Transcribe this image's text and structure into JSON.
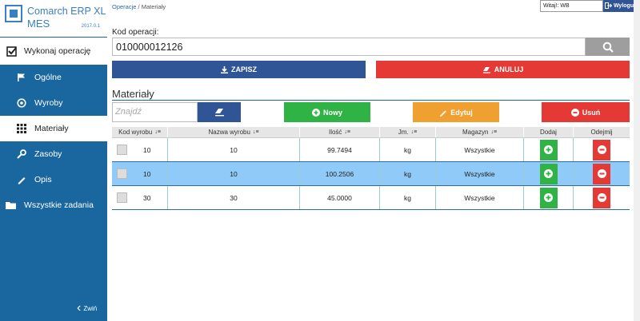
{
  "app": {
    "title": "Comarch ERP XL",
    "subtitle": "MES",
    "version": "2017.0.1"
  },
  "sidebar": {
    "top_item": "Wykonaj operację",
    "items": [
      {
        "label": "Ogólne",
        "icon": "flag-icon"
      },
      {
        "label": "Wyroby",
        "icon": "target-icon"
      },
      {
        "label": "Materiały",
        "icon": "grid-icon"
      },
      {
        "label": "Zasoby",
        "icon": "wrench-icon"
      },
      {
        "label": "Opis",
        "icon": "pencil-icon"
      }
    ],
    "all_tasks": "Wszystkie zadania",
    "collapse": "Zwiń"
  },
  "header": {
    "breadcrumb": [
      "Operacje",
      "Materiały"
    ],
    "welcome": "Witaj!: WB",
    "logout": "Wyloguj"
  },
  "form": {
    "kod_label": "Kod operacji:",
    "kod_value": "010000012126",
    "save": "ZAPISZ",
    "cancel": "ANULUJ"
  },
  "materials": {
    "title": "Materiały",
    "find_placeholder": "Znajdź",
    "new": "Nowy",
    "edit": "Edytuj",
    "delete": "Usuń",
    "columns": [
      "Kod wyrobu",
      "Nazwa wyrobu",
      "Ilość",
      "Jm.",
      "Magazyn",
      "Dodaj",
      "Odejmij"
    ],
    "rows": [
      {
        "kod": "10",
        "nazwa": "10",
        "ilosc": "99.7494",
        "jm": "kg",
        "magazyn": "Wszystkie"
      },
      {
        "kod": "10",
        "nazwa": "10",
        "ilosc": "100.2506",
        "jm": "kg",
        "magazyn": "Wszystkie"
      },
      {
        "kod": "30",
        "nazwa": "30",
        "ilosc": "45.0000",
        "jm": "kg",
        "magazyn": "Wszystkie"
      }
    ]
  },
  "colors": {
    "sidebar": "#1a67a0",
    "primary": "#2f5597",
    "danger": "#e53935",
    "success": "#2fb344",
    "warning": "#f0a030",
    "selected_row": "#90caf9"
  }
}
